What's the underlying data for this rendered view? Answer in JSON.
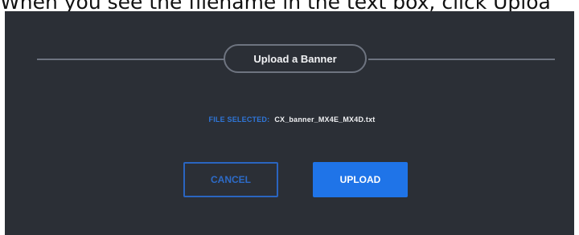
{
  "instruction": {
    "text": "When you see the filename in the text box, click Uploa"
  },
  "dialog": {
    "title": "Upload a Banner",
    "file_selected_label": "FILE SELECTED:",
    "file_name": "CX_banner_MX4E_MX4D.txt",
    "cancel_label": "CANCEL",
    "upload_label": "UPLOAD"
  },
  "colors": {
    "dialog_background": "#2b2f36",
    "accent_blue": "#1f74e8",
    "label_blue": "#2f76d8",
    "divider": "#6d7380"
  }
}
